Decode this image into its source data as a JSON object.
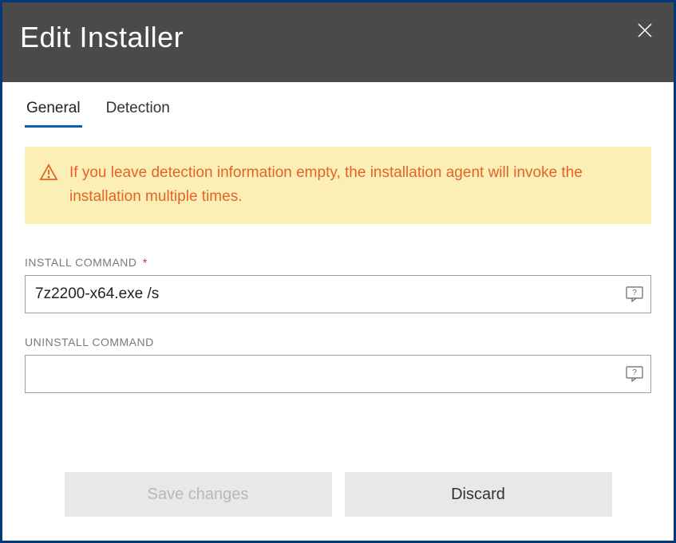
{
  "header": {
    "title": "Edit Installer"
  },
  "tabs": {
    "general": "General",
    "detection": "Detection"
  },
  "warning": {
    "text": "If you leave detection information empty, the installation agent will invoke the installation multiple times."
  },
  "fields": {
    "install": {
      "label": "INSTALL COMMAND",
      "required_marker": "*",
      "value": "7z2200-x64.exe /s"
    },
    "uninstall": {
      "label": "UNINSTALL COMMAND",
      "value": ""
    }
  },
  "buttons": {
    "save": "Save changes",
    "discard": "Discard"
  }
}
